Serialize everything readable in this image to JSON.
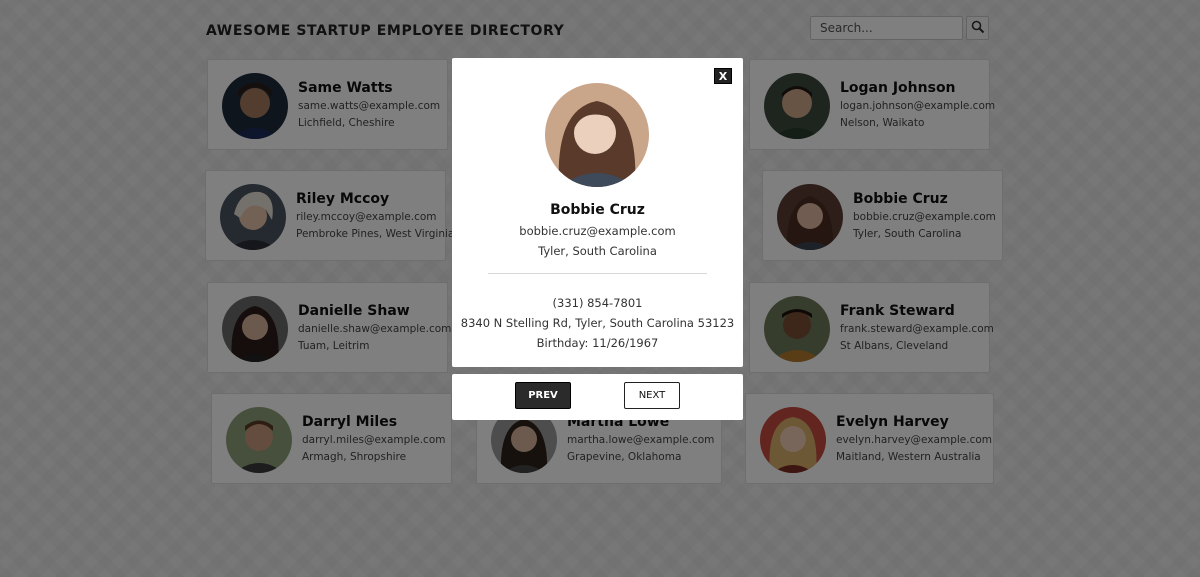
{
  "header": {
    "title": "AWESOME STARTUP EMPLOYEE DIRECTORY"
  },
  "search": {
    "placeholder": "Search...",
    "button_icon": "magnifier-icon"
  },
  "employees": [
    {
      "name": "Same Watts",
      "email": "same.watts@example.com",
      "location": "Lichfield, Cheshire"
    },
    {
      "name": "Logan Johnson",
      "email": "logan.johnson@example.com",
      "location": "Nelson, Waikato"
    },
    {
      "name": "Riley Mccoy",
      "email": "riley.mccoy@example.com",
      "location": "Pembroke Pines, West Virginia"
    },
    {
      "name": "Bobbie Cruz",
      "email": "bobbie.cruz@example.com",
      "location": "Tyler, South Carolina"
    },
    {
      "name": "Danielle Shaw",
      "email": "danielle.shaw@example.com",
      "location": "Tuam, Leitrim"
    },
    {
      "name": "Frank Steward",
      "email": "frank.steward@example.com",
      "location": "St Albans, Cleveland"
    },
    {
      "name": "Darryl Miles",
      "email": "darryl.miles@example.com",
      "location": "Armagh, Shropshire"
    },
    {
      "name": "Martha Lowe",
      "email": "martha.lowe@example.com",
      "location": "Grapevine, Oklahoma"
    },
    {
      "name": "Evelyn Harvey",
      "email": "evelyn.harvey@example.com",
      "location": "Maitland, Western Australia"
    }
  ],
  "modal": {
    "close_label": "X",
    "name": "Bobbie Cruz",
    "email": "bobbie.cruz@example.com",
    "city": "Tyler, South Carolina",
    "phone": "(331) 854-7801",
    "address": "8340 N Stelling Rd, Tyler, South Carolina 53123",
    "birthday": "Birthday: 11/26/1967"
  },
  "nav": {
    "prev_label": "PREV",
    "next_label": "NEXT"
  }
}
